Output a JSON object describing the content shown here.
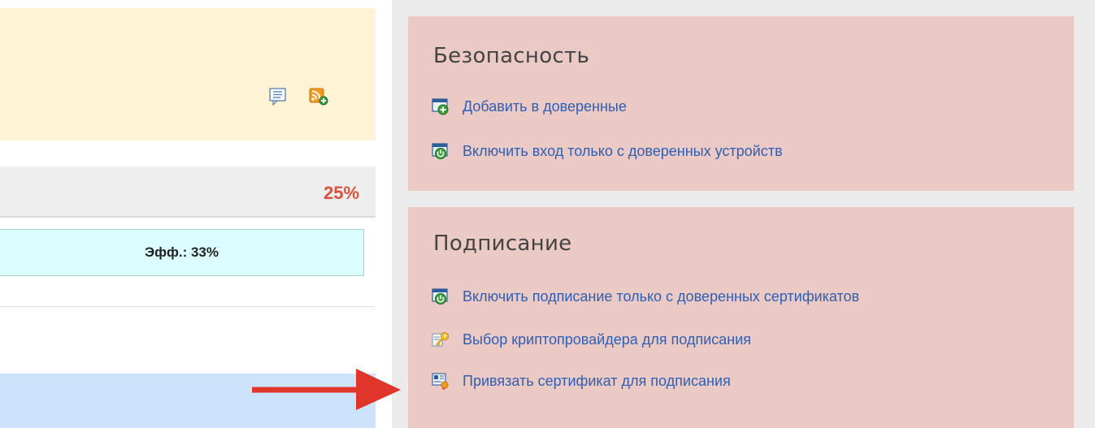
{
  "left": {
    "notice_icons": [
      "comment-icon",
      "rss-feed-icon"
    ],
    "progress": {
      "percent_text": "25%",
      "color": "#d9533c"
    },
    "efficiency": {
      "label": "Эфф.: 33%"
    }
  },
  "security": {
    "title": "Безопасность",
    "links": [
      {
        "label": "Добавить в доверенные",
        "icon": "add-trusted-icon"
      },
      {
        "label": "Включить вход только с доверенных устройств",
        "icon": "power-trusted-icon"
      }
    ]
  },
  "signing": {
    "title": "Подписание",
    "links": [
      {
        "label": "Включить подписание только с доверенных сертификатов",
        "icon": "power-trusted-icon"
      },
      {
        "label": "Выбор криптопровайдера для подписания",
        "icon": "key-icon"
      },
      {
        "label": "Привязать сертификат для подписания",
        "icon": "certificate-icon"
      }
    ]
  },
  "colors": {
    "link": "#2f5fb5",
    "panel": "#ebc9c4",
    "notice": "#fff3d6",
    "arrow": "#e0352b"
  }
}
